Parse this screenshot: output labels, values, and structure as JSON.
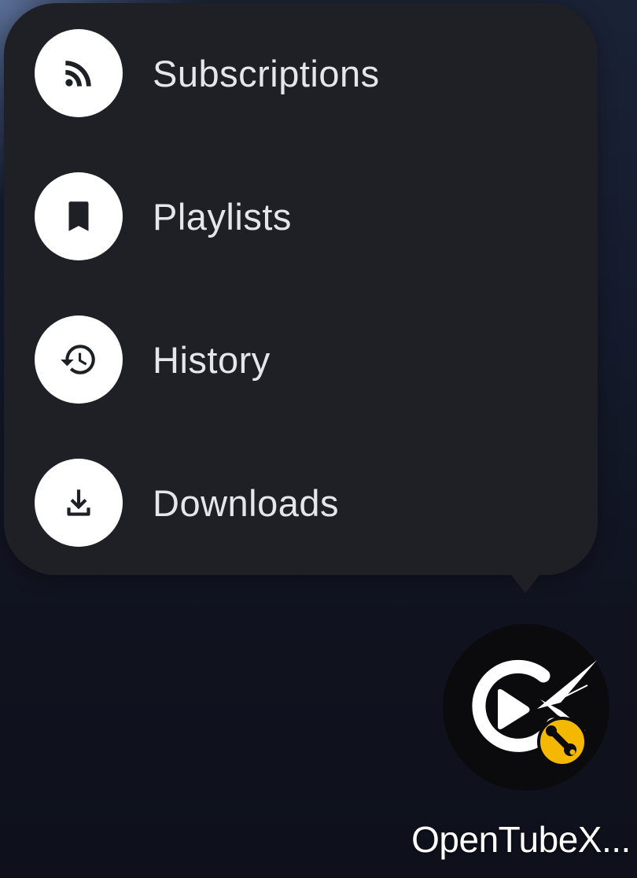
{
  "shortcuts": {
    "items": [
      {
        "label": "Subscriptions",
        "icon": "rss-icon"
      },
      {
        "label": "Playlists",
        "icon": "bookmark-icon"
      },
      {
        "label": "History",
        "icon": "history-icon"
      },
      {
        "label": "Downloads",
        "icon": "download-icon"
      }
    ]
  },
  "app": {
    "name": "OpenTubeX...",
    "icon": "opentubex-logo-icon",
    "badge_icon": "wrench-icon",
    "badge_color": "#f5b800"
  },
  "colors": {
    "popup_background": "#1f2025",
    "icon_circle": "#ffffff",
    "icon_glyph": "#1f2025",
    "label_text": "#e6e6ea"
  }
}
